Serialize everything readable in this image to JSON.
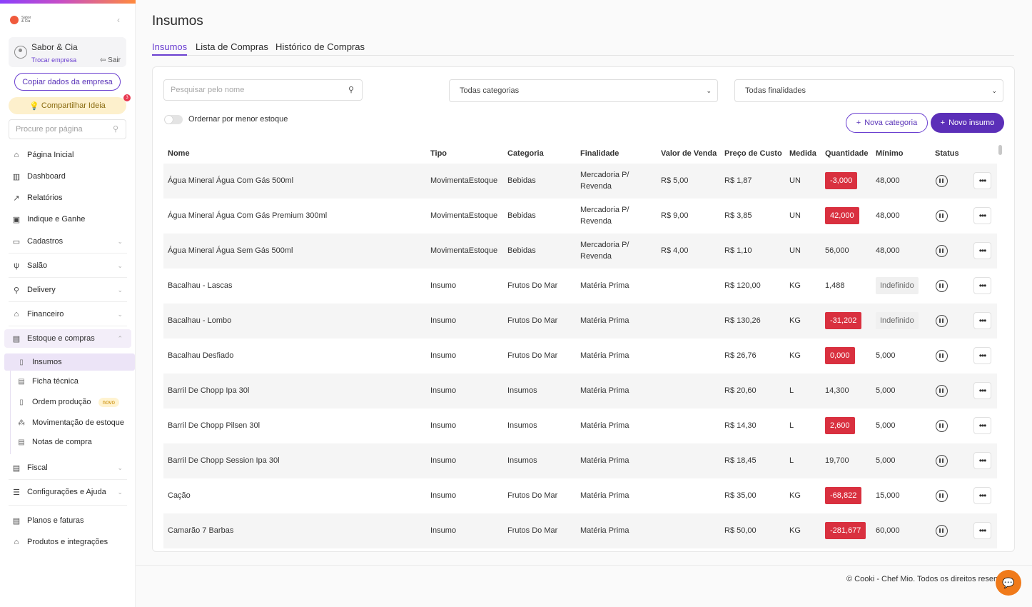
{
  "brand": {
    "text": "Sabor & Cia",
    "collapse_icon": "chevron-left-icon"
  },
  "company": {
    "name": "Sabor & Cia",
    "switch_label": "Trocar empresa",
    "logout_label": "Sair"
  },
  "sidebar": {
    "copy_button": "Copiar dados da empresa",
    "share_button": "Compartilhar Ideia",
    "share_badge": "3",
    "search_placeholder": "Procure por página",
    "items": [
      {
        "label": "Página Inicial",
        "icon": "home-icon"
      },
      {
        "label": "Dashboard",
        "icon": "chart-icon"
      },
      {
        "label": "Relatórios",
        "icon": "trend-icon"
      },
      {
        "label": "Indique e Ganhe",
        "icon": "gift-icon"
      },
      {
        "label": "Cadastros",
        "icon": "folder-icon"
      },
      {
        "label": "Salão",
        "icon": "cutlery-icon"
      },
      {
        "label": "Delivery",
        "icon": "bike-icon"
      },
      {
        "label": "Financeiro",
        "icon": "bank-icon"
      },
      {
        "label": "Estoque e compras",
        "icon": "box-icon"
      },
      {
        "label": "Fiscal",
        "icon": "receipt-icon"
      },
      {
        "label": "Configurações e Ajuda",
        "icon": "sliders-icon"
      },
      {
        "label": "Planos e faturas",
        "icon": "invoice-icon"
      },
      {
        "label": "Produtos e integrações",
        "icon": "store-icon"
      }
    ],
    "subitems": [
      {
        "label": "Insumos",
        "icon": "clipboard-icon"
      },
      {
        "label": "Ficha técnica",
        "icon": "sheet-icon"
      },
      {
        "label": "Ordem produção",
        "icon": "order-icon",
        "badge": "novo"
      },
      {
        "label": "Movimentação de estoque",
        "icon": "boxes-icon"
      },
      {
        "label": "Notas de compra",
        "icon": "note-icon"
      }
    ]
  },
  "page": {
    "title": "Insumos"
  },
  "tabs": [
    "Insumos",
    "Lista de Compras",
    "Histórico de Compras"
  ],
  "filters": {
    "search_placeholder": "Pesquisar pelo nome",
    "category_select": "Todas categorias",
    "purpose_select": "Todas finalidades",
    "sort_toggle_label": "Ordernar por menor estoque"
  },
  "actions": {
    "new_category": "Nova categoria",
    "new_item": "Novo insumo"
  },
  "table": {
    "columns": [
      "Nome",
      "Tipo",
      "Categoria",
      "Finalidade",
      "Valor de Venda",
      "Preço de Custo",
      "Medida",
      "Quantidade",
      "Mínimo",
      "Status"
    ],
    "rows": [
      {
        "nome": "Água Mineral Água Com Gás 500ml",
        "tipo": "MovimentaEstoque",
        "categoria": "Bebidas",
        "finalidade": [
          "Mercadoria P/",
          "Revenda"
        ],
        "venda": "R$ 5,00",
        "custo": "R$ 1,87",
        "medida": "UN",
        "quantidade": "-3,000",
        "qtd_alert": true,
        "minimo": "48,000",
        "min_undef": false
      },
      {
        "nome": "Água Mineral Água Com Gás Premium 300ml",
        "tipo": "MovimentaEstoque",
        "categoria": "Bebidas",
        "finalidade": [
          "Mercadoria P/",
          "Revenda"
        ],
        "venda": "R$ 9,00",
        "custo": "R$ 3,85",
        "medida": "UN",
        "quantidade": "42,000",
        "qtd_alert": true,
        "minimo": "48,000",
        "min_undef": false
      },
      {
        "nome": "Água Mineral Água Sem Gás 500ml",
        "tipo": "MovimentaEstoque",
        "categoria": "Bebidas",
        "finalidade": [
          "Mercadoria P/",
          "Revenda"
        ],
        "venda": "R$ 4,00",
        "custo": "R$ 1,10",
        "medida": "UN",
        "quantidade": "56,000",
        "qtd_alert": false,
        "minimo": "48,000",
        "min_undef": false
      },
      {
        "nome": "Bacalhau - Lascas",
        "tipo": "Insumo",
        "categoria": "Frutos Do Mar",
        "finalidade": [
          "Matéria Prima"
        ],
        "venda": "",
        "custo": "R$ 120,00",
        "medida": "KG",
        "quantidade": "1,488",
        "qtd_alert": false,
        "minimo": "Indefinido",
        "min_undef": true
      },
      {
        "nome": "Bacalhau - Lombo",
        "tipo": "Insumo",
        "categoria": "Frutos Do Mar",
        "finalidade": [
          "Matéria Prima"
        ],
        "venda": "",
        "custo": "R$ 130,26",
        "medida": "KG",
        "quantidade": "-31,202",
        "qtd_alert": true,
        "minimo": "Indefinido",
        "min_undef": true
      },
      {
        "nome": "Bacalhau Desfiado",
        "tipo": "Insumo",
        "categoria": "Frutos Do Mar",
        "finalidade": [
          "Matéria Prima"
        ],
        "venda": "",
        "custo": "R$ 26,76",
        "medida": "KG",
        "quantidade": "0,000",
        "qtd_alert": true,
        "minimo": "5,000",
        "min_undef": false
      },
      {
        "nome": "Barril De Chopp Ipa 30l",
        "tipo": "Insumo",
        "categoria": "Insumos",
        "finalidade": [
          "Matéria Prima"
        ],
        "venda": "",
        "custo": "R$ 20,60",
        "medida": "L",
        "quantidade": "14,300",
        "qtd_alert": false,
        "minimo": "5,000",
        "min_undef": false
      },
      {
        "nome": "Barril De Chopp Pilsen 30l",
        "tipo": "Insumo",
        "categoria": "Insumos",
        "finalidade": [
          "Matéria Prima"
        ],
        "venda": "",
        "custo": "R$ 14,30",
        "medida": "L",
        "quantidade": "2,600",
        "qtd_alert": true,
        "minimo": "5,000",
        "min_undef": false
      },
      {
        "nome": "Barril De Chopp Session Ipa 30l",
        "tipo": "Insumo",
        "categoria": "Insumos",
        "finalidade": [
          "Matéria Prima"
        ],
        "venda": "",
        "custo": "R$ 18,45",
        "medida": "L",
        "quantidade": "19,700",
        "qtd_alert": false,
        "minimo": "5,000",
        "min_undef": false
      },
      {
        "nome": "Cação",
        "tipo": "Insumo",
        "categoria": "Frutos Do Mar",
        "finalidade": [
          "Matéria Prima"
        ],
        "venda": "",
        "custo": "R$ 35,00",
        "medida": "KG",
        "quantidade": "-68,822",
        "qtd_alert": true,
        "minimo": "15,000",
        "min_undef": false
      },
      {
        "nome": "Camarão 7 Barbas",
        "tipo": "Insumo",
        "categoria": "Frutos Do Mar",
        "finalidade": [
          "Matéria Prima"
        ],
        "venda": "",
        "custo": "R$ 50,00",
        "medida": "KG",
        "quantidade": "-281,677",
        "qtd_alert": true,
        "minimo": "60,000",
        "min_undef": false
      }
    ]
  },
  "footer": {
    "text": "© Cooki - Chef Mio. Todos os direitos reservados"
  },
  "colors": {
    "accent": "#5b2fb8",
    "alert": "#d9303f",
    "chat": "#f07a1a"
  }
}
